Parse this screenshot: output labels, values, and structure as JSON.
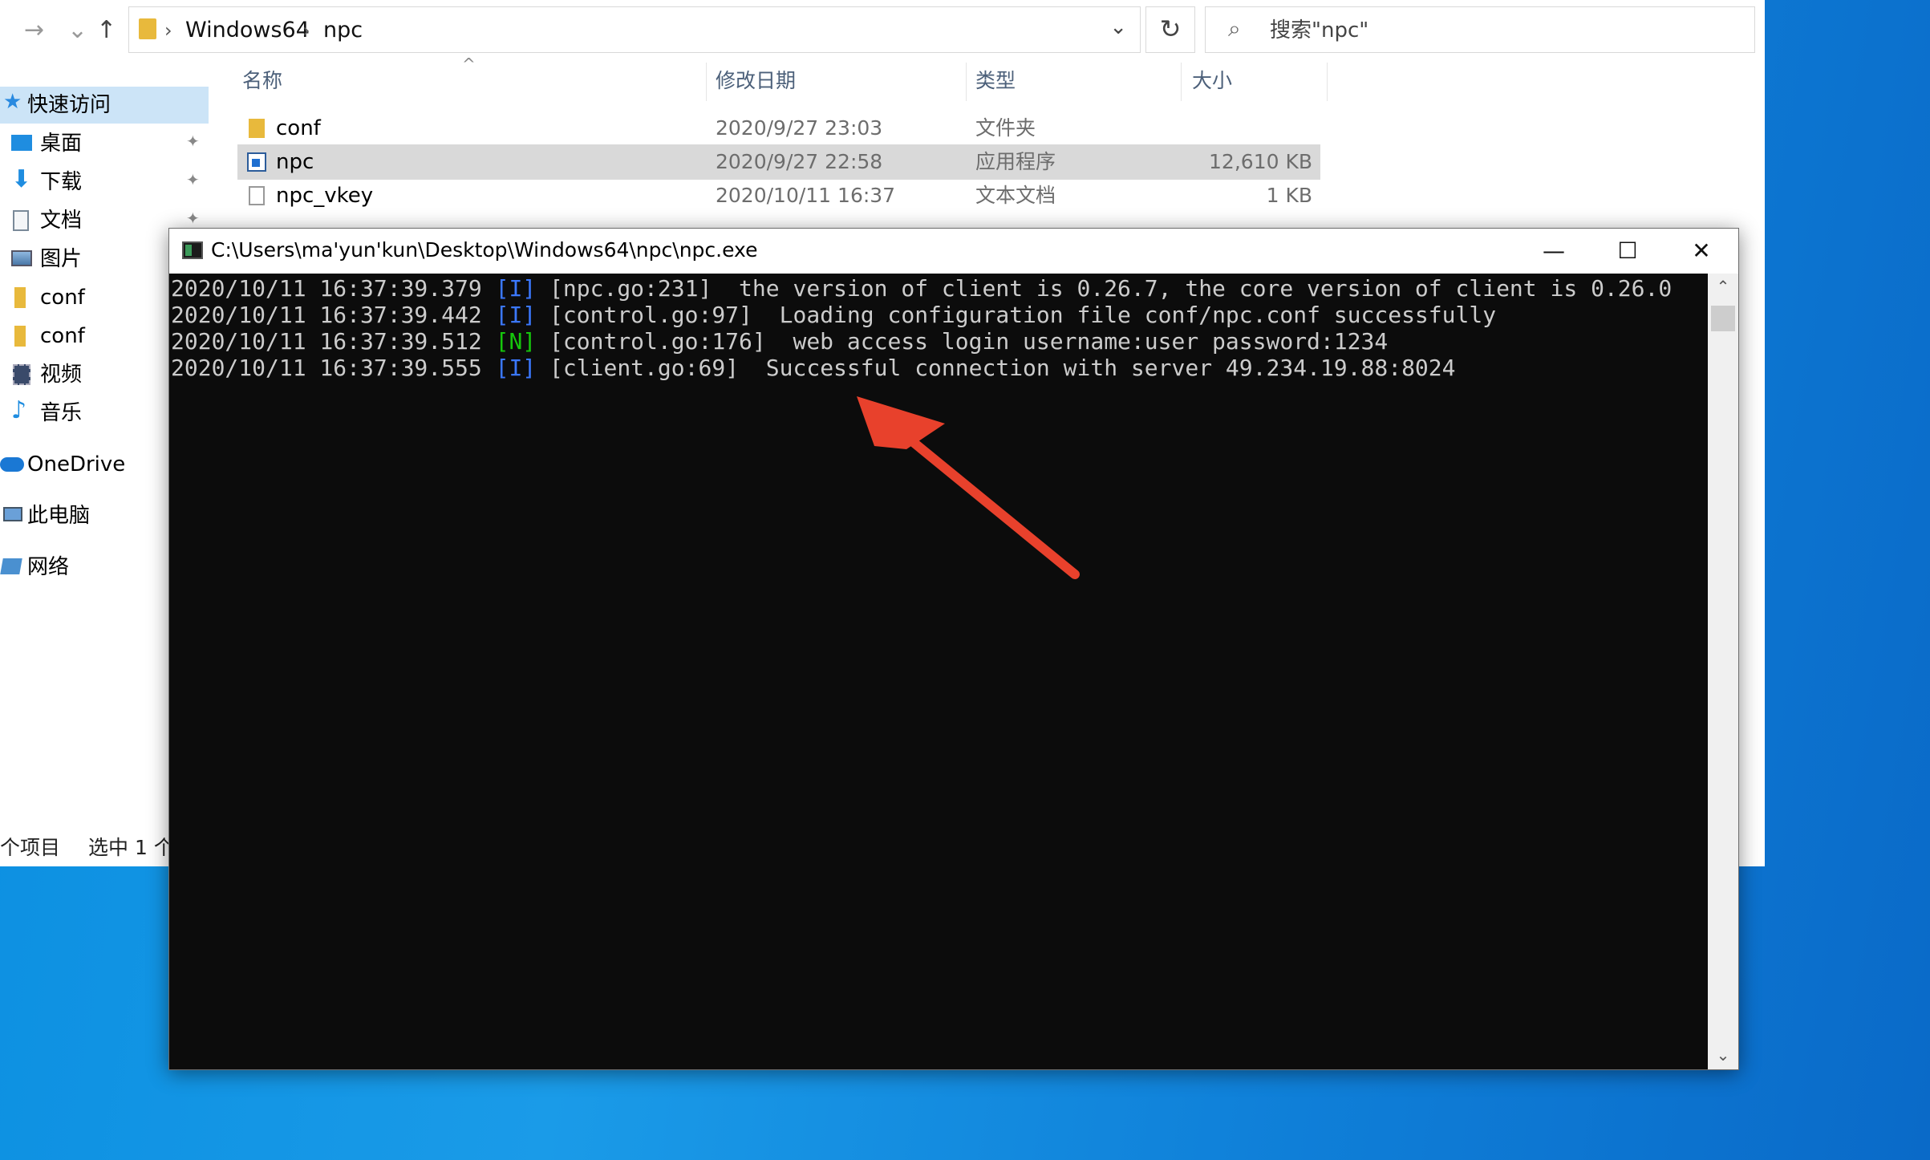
{
  "explorer": {
    "nav": {
      "back": "→",
      "history": "⌄",
      "up": "↑"
    },
    "address": {
      "crumbs": [
        "Windows64",
        "npc"
      ],
      "separator": "›",
      "dropdown": "⌄"
    },
    "refresh": "↻",
    "search": {
      "placeholder": "搜索\"npc\"",
      "icon": "⌕"
    },
    "sidebar": [
      {
        "label": "快速访问",
        "icon": "star-icon"
      },
      {
        "label": "桌面",
        "icon": "desktop-icon"
      },
      {
        "label": "下载",
        "icon": "download-icon"
      },
      {
        "label": "文档",
        "icon": "document-icon"
      },
      {
        "label": "图片",
        "icon": "picture-icon"
      },
      {
        "label": "conf",
        "icon": "folder-icon"
      },
      {
        "label": "conf",
        "icon": "folder-icon"
      },
      {
        "label": "视频",
        "icon": "video-icon"
      },
      {
        "label": "音乐",
        "icon": "music-icon"
      },
      {
        "label": "OneDrive",
        "icon": "cloud-icon"
      },
      {
        "label": "此电脑",
        "icon": "computer-icon"
      },
      {
        "label": "网络",
        "icon": "network-icon"
      }
    ],
    "pin_glyph": "📌",
    "columns": {
      "name": "名称",
      "date": "修改日期",
      "type": "类型",
      "size": "大小"
    },
    "sort_caret": "^",
    "files": [
      {
        "name": "conf",
        "date": "2020/9/27 23:03",
        "type": "文件夹",
        "size": ""
      },
      {
        "name": "npc",
        "date": "2020/9/27 22:58",
        "type": "应用程序",
        "size": "12,610 KB"
      },
      {
        "name": "npc_vkey",
        "date": "2020/10/11 16:37",
        "type": "文本文档",
        "size": "1 KB"
      }
    ],
    "status": {
      "count": "个项目",
      "selected": "选中 1 个"
    }
  },
  "console": {
    "title": "C:\\Users\\ma'yun'kun\\Desktop\\Windows64\\npc\\npc.exe",
    "buttons": {
      "minimize": "—",
      "maximize": "☐",
      "close": "✕"
    },
    "lines": [
      {
        "time": "2020/10/11 16:37:39.379",
        "level": "[I]",
        "src": "[npc.go:231]",
        "msg": "the version of client is 0.26.7, the core version of client is 0.26.0"
      },
      {
        "time": "2020/10/11 16:37:39.442",
        "level": "[I]",
        "src": "[control.go:97]",
        "msg": "Loading configuration file conf/npc.conf successfully"
      },
      {
        "time": "2020/10/11 16:37:39.512",
        "level": "[N]",
        "src": "[control.go:176]",
        "msg": "web access login username:user password:1234"
      },
      {
        "time": "2020/10/11 16:37:39.555",
        "level": "[I]",
        "src": "[client.go:69]",
        "msg": "Successful connection with server 49.234.19.88:8024"
      }
    ],
    "scroll": {
      "up": "⌃",
      "down": "⌄"
    }
  },
  "colors": {
    "info": "#3b78ff",
    "notice": "#16c60c",
    "arrow": "#e8412c"
  }
}
